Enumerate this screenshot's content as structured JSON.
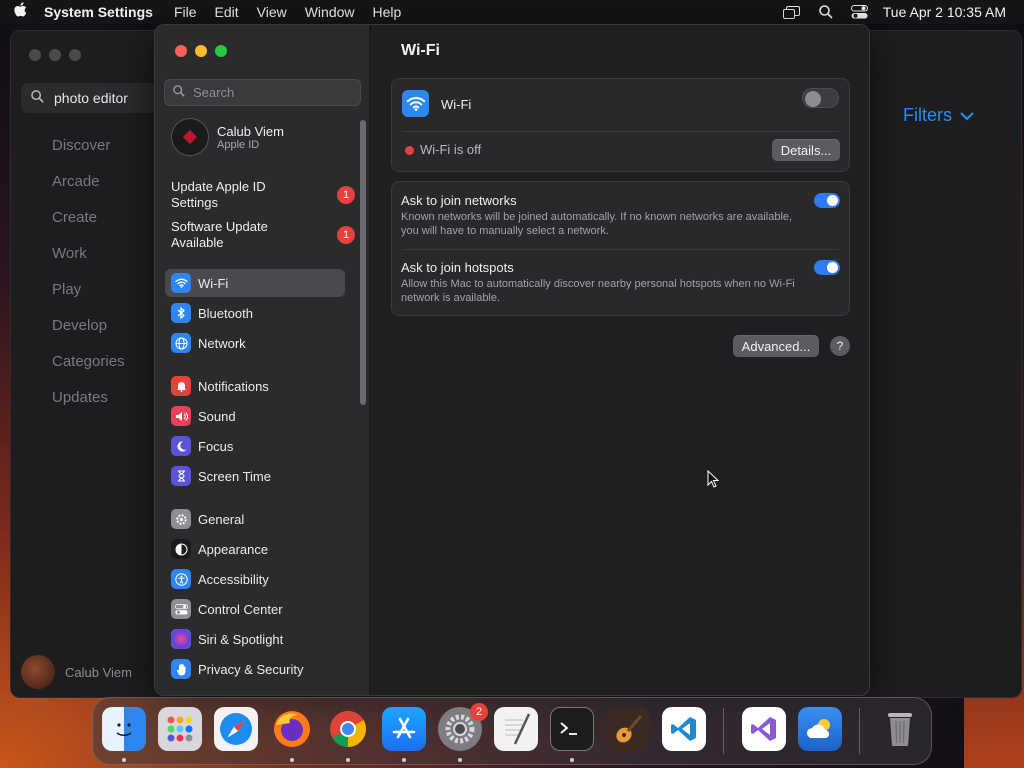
{
  "menubar": {
    "app_name": "System Settings",
    "items": [
      "File",
      "Edit",
      "View",
      "Window",
      "Help"
    ],
    "datetime": "Tue Apr 2  10:35 AM"
  },
  "background_window": {
    "search_value": "photo editor",
    "nav": [
      "Discover",
      "Arcade",
      "Create",
      "Work",
      "Play",
      "Develop",
      "Categories",
      "Updates"
    ],
    "user": "Calub Viem",
    "filters_label": "Filters"
  },
  "sidebar": {
    "search_placeholder": "Search",
    "account": {
      "name": "Calub Viem",
      "subtitle": "Apple ID"
    },
    "notices": [
      {
        "label": "Update Apple ID Settings",
        "badge": "1"
      },
      {
        "label": "Software Update Available",
        "badge": "1"
      }
    ],
    "items": [
      {
        "label": "Wi-Fi",
        "icon": "wifi-icon",
        "color": "#2e86f0",
        "selected": true
      },
      {
        "label": "Bluetooth",
        "icon": "bluetooth-icon",
        "color": "#2e86f0"
      },
      {
        "label": "Network",
        "icon": "globe-icon",
        "color": "#2e86f0"
      },
      {
        "label": "Notifications",
        "icon": "bell-icon",
        "color": "#e8403a"
      },
      {
        "label": "Sound",
        "icon": "speaker-icon",
        "color": "#e8405a"
      },
      {
        "label": "Focus",
        "icon": "moon-icon",
        "color": "#5b54d6"
      },
      {
        "label": "Screen Time",
        "icon": "hourglass-icon",
        "color": "#5b54d6"
      },
      {
        "label": "General",
        "icon": "gear-icon",
        "color": "#8e8e93"
      },
      {
        "label": "Appearance",
        "icon": "appearance-icon",
        "color": "#1c1c1e"
      },
      {
        "label": "Accessibility",
        "icon": "accessibility-icon",
        "color": "#2e86f0"
      },
      {
        "label": "Control Center",
        "icon": "control-center-icon",
        "color": "#8e8e93"
      },
      {
        "label": "Siri & Spotlight",
        "icon": "siri-icon",
        "color": "#6a3fd6"
      },
      {
        "label": "Privacy & Security",
        "icon": "hand-icon",
        "color": "#2e86f0"
      }
    ]
  },
  "main": {
    "title": "Wi-Fi",
    "wifi_label": "Wi-Fi",
    "wifi_on": false,
    "status_text": "Wi-Fi is off",
    "details_button": "Details...",
    "options": [
      {
        "title": "Ask to join networks",
        "desc": "Known networks will be joined automatically. If no known networks are available, you will have to manually select a network.",
        "on": true
      },
      {
        "title": "Ask to join hotspots",
        "desc": "Allow this Mac to automatically discover nearby personal hotspots when no Wi-Fi network is available.",
        "on": true
      }
    ],
    "advanced_button": "Advanced...",
    "help_button": "?"
  },
  "dock": {
    "apps": [
      {
        "name": "finder",
        "icon": "finder-icon",
        "color": "#2e86f0",
        "running": true
      },
      {
        "name": "launchpad",
        "icon": "launchpad-icon",
        "color": "#d8d8dc",
        "running": false
      },
      {
        "name": "safari",
        "icon": "safari-icon",
        "color": "#1f8cf0",
        "running": false
      },
      {
        "name": "firefox",
        "icon": "firefox-icon",
        "color": "#ff7a1a",
        "running": true
      },
      {
        "name": "chrome",
        "icon": "chrome-icon",
        "color": "#ffffff",
        "running": true
      },
      {
        "name": "app-store",
        "icon": "app-store-icon",
        "color": "#1d8cf5",
        "running": true
      },
      {
        "name": "system-settings",
        "icon": "gear-icon",
        "color": "#7c7c82",
        "running": true,
        "badge": "2"
      },
      {
        "name": "textedit",
        "icon": "textedit-icon",
        "color": "#f2f2f2",
        "running": false
      },
      {
        "name": "terminal",
        "icon": "terminal-icon",
        "color": "#1c1c1e",
        "running": true
      },
      {
        "name": "garageband",
        "icon": "guitar-icon",
        "color": "#3a2a22",
        "running": false
      },
      {
        "name": "vscode",
        "icon": "vscode-icon",
        "color": "#ffffff",
        "running": false
      },
      {
        "name": "visual-studio",
        "icon": "visual-studio-icon",
        "color": "#ffffff",
        "running": false
      },
      {
        "name": "weather",
        "icon": "weather-icon",
        "color": "#2a7fe0",
        "running": false
      },
      {
        "name": "trash",
        "icon": "trash-icon",
        "color": "#9a9a9e",
        "running": false
      }
    ]
  }
}
